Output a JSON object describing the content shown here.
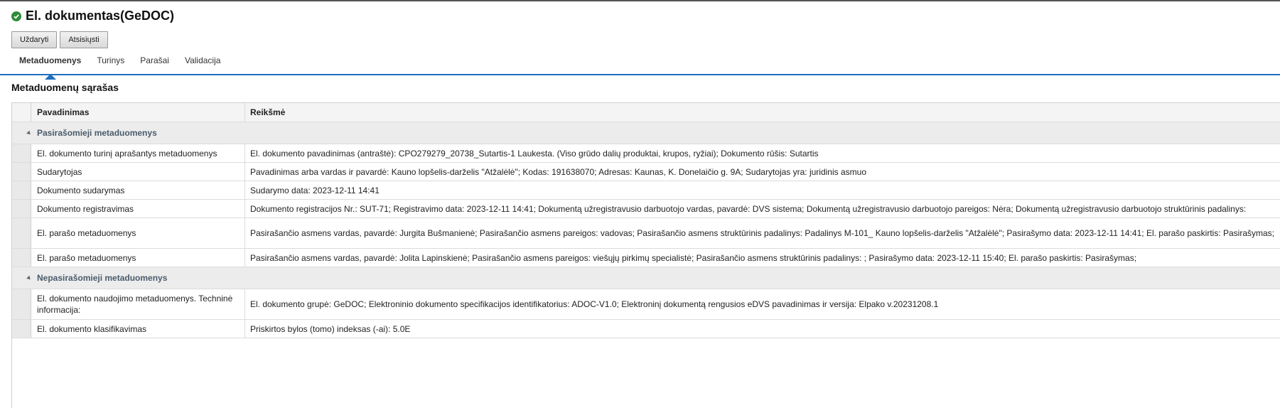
{
  "header": {
    "title": "El. dokumentas(GeDOC)",
    "status_icon": "check-circle-icon",
    "status_color": "#2e8b3a"
  },
  "toolbar": {
    "close_label": "Uždaryti",
    "download_label": "Atsisiųsti"
  },
  "tabs": [
    {
      "label": "Metaduomenys",
      "active": true
    },
    {
      "label": "Turinys",
      "active": false
    },
    {
      "label": "Parašai",
      "active": false
    },
    {
      "label": "Validacija",
      "active": false
    }
  ],
  "accent_color": "#1f6fbf",
  "section": {
    "title": "Metaduomenų sąrašas"
  },
  "table": {
    "headers": {
      "name": "Pavadinimas",
      "value": "Reikšmė"
    },
    "groups": [
      {
        "label": "Pasirašomieji metaduomenys",
        "rows": [
          {
            "name": "El. dokumento turinį aprašantys metaduomenys",
            "value": "El. dokumento pavadinimas (antraštė): CPO279279_20738_Sutartis-1 Laukesta. (Viso grūdo dalių produktai, krupos, ryžiai); Dokumento rūšis: Sutartis"
          },
          {
            "name": "Sudarytojas",
            "value": "Pavadinimas arba vardas ir pavardė: Kauno lopšelis-darželis \"Atžalėlė\"; Kodas: 191638070; Adresas: Kaunas, K. Donelaičio g. 9A; Sudarytojas yra: juridinis asmuo"
          },
          {
            "name": "Dokumento sudarymas",
            "value": "Sudarymo data: 2023-12-11 14:41"
          },
          {
            "name": "Dokumento registravimas",
            "value": "Dokumento registracijos Nr.: SUT-71; Registravimo data: 2023-12-11 14:41; Dokumentą užregistravusio darbuotojo vardas, pavardė: DVS sistema; Dokumentą užregistravusio darbuotojo pareigos: Nėra; Dokumentą užregistravusio darbuotojo struktūrinis padalinys:"
          },
          {
            "name": "El. parašo metaduomenys",
            "value": "Pasirašančio asmens vardas, pavardė: Jurgita Bušmanienė; Pasirašančio asmens pareigos: vadovas; Pasirašančio asmens struktūrinis padalinys: Padalinys M-101_ Kauno lopšelis-darželis \"Atžalėlė\"; Pasirašymo data: 2023-12-11 14:41; El. parašo paskirtis: Pasirašymas;"
          },
          {
            "name": "El. parašo metaduomenys",
            "value": "Pasirašančio asmens vardas, pavardė: Jolita Lapinskienė; Pasirašančio asmens pareigos: viešųjų pirkimų specialistė; Pasirašančio asmens struktūrinis padalinys: ; Pasirašymo data: 2023-12-11 15:40; El. parašo paskirtis: Pasirašymas;"
          }
        ]
      },
      {
        "label": "Nepasirašomieji metaduomenys",
        "rows": [
          {
            "name": "El. dokumento naudojimo metaduomenys. Techninė informacija:",
            "value": "El. dokumento grupė: GeDOC; Elektroninio dokumento specifikacijos identifikatorius: ADOC-V1.0; Elektroninį dokumentą rengusios eDVS pavadinimas ir versija: Elpako v.20231208.1"
          },
          {
            "name": "El. dokumento klasifikavimas",
            "value": "Priskirtos bylos (tomo) indeksas (-ai): 5.0E"
          }
        ]
      }
    ]
  }
}
